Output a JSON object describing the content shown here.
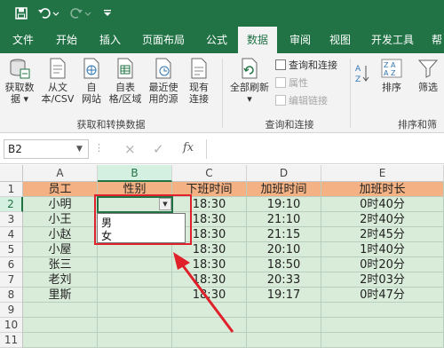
{
  "quick_access": {
    "save_icon": "save-icon",
    "undo_icon": "undo-icon",
    "redo_icon": "redo-icon",
    "customize_icon": "customize-icon"
  },
  "tabs": [
    {
      "label": "文件"
    },
    {
      "label": "开始"
    },
    {
      "label": "插入"
    },
    {
      "label": "页面布局"
    },
    {
      "label": "公式"
    },
    {
      "label": "数据"
    },
    {
      "label": "审阅"
    },
    {
      "label": "视图"
    },
    {
      "label": "开发工具"
    },
    {
      "label": "帮"
    }
  ],
  "active_tab": "数据",
  "ribbon": {
    "get_data_line1": "获取数",
    "get_data_line2": "据 ▾",
    "from_text_line1": "从文",
    "from_text_line2": "本/CSV",
    "from_web_line1": "自",
    "from_web_line2": "网站",
    "from_table_line1": "自表",
    "from_table_line2": "格/区域",
    "recent_line1": "最近使",
    "recent_line2": "用的源",
    "existing_line1": "现有",
    "existing_line2": "连接",
    "group1_label": "获取和转换数据",
    "refresh_line1": "全部刷新",
    "refresh_line2": "▾",
    "queries_connections": "查询和连接",
    "properties": "属性",
    "edit_links": "编辑链接",
    "group2_label": "查询和连接",
    "sort_az": "A↓Z",
    "sort_label": "排序",
    "filter_label": "筛选",
    "group3_label": "排序和筛"
  },
  "formula_bar": {
    "name_box": "B2",
    "fx": "fx",
    "cancel_icon": "×",
    "enter_icon": "✓",
    "value": ""
  },
  "grid": {
    "columns": [
      "A",
      "B",
      "C",
      "D",
      "E"
    ],
    "selected_column": "B",
    "rows": [
      "1",
      "2",
      "3",
      "4",
      "5",
      "6",
      "7",
      "8",
      "9",
      "10",
      "11"
    ],
    "selected_row": "2",
    "header": [
      "员工",
      "性别",
      "下班时间",
      "加班时间",
      "加班时长"
    ],
    "data": [
      [
        "小明",
        "",
        "18:30",
        "19:10",
        "0时40分"
      ],
      [
        "小王",
        "",
        "18:30",
        "21:10",
        "2时40分"
      ],
      [
        "小赵",
        "",
        "18:30",
        "21:15",
        "2时45分"
      ],
      [
        "小屋",
        "",
        "18:30",
        "20:10",
        "1时40分"
      ],
      [
        "张三",
        "",
        "18:30",
        "18:50",
        "0时20分"
      ],
      [
        "老刘",
        "",
        "18:30",
        "20:33",
        "2时03分"
      ],
      [
        "里斯",
        "",
        "18:30",
        "19:17",
        "0时47分"
      ]
    ]
  },
  "dropdown": {
    "options": [
      "男",
      "女"
    ]
  },
  "colors": {
    "excel_green": "#217346",
    "header_fill": "#f4b183",
    "body_fill": "#d9ecd9",
    "annotation_red": "#e0202a"
  }
}
